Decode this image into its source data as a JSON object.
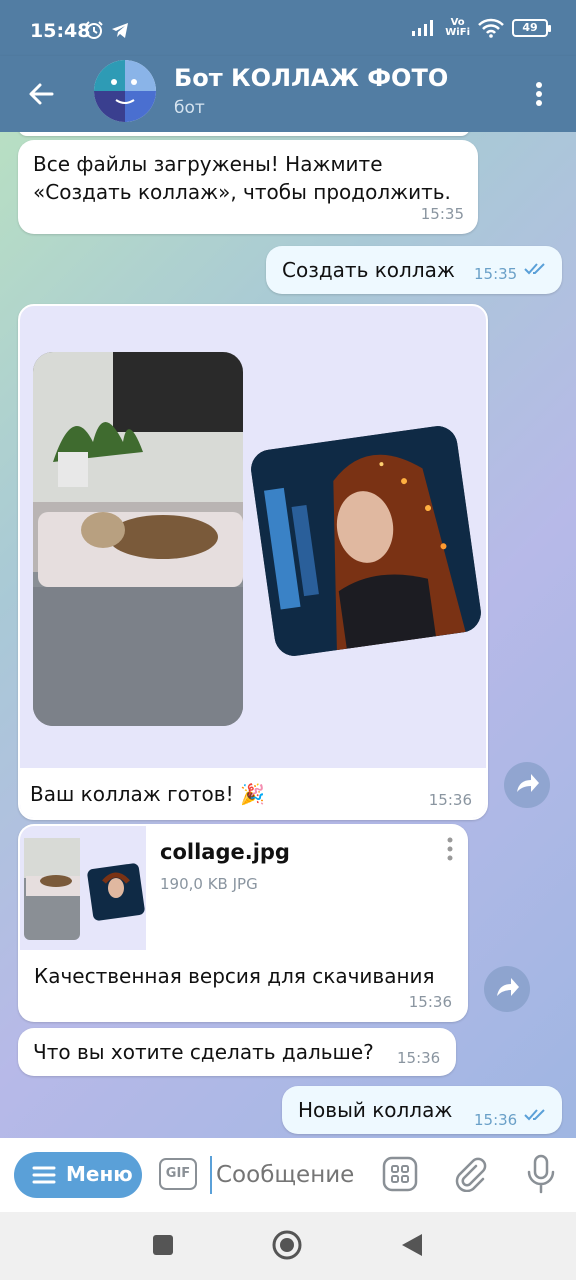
{
  "status": {
    "time": "15:48",
    "vowifi_top": "Vo",
    "vowifi_bottom": "WiFi",
    "battery": "49"
  },
  "header": {
    "title": "Бот КОЛЛАЖ ФОТО",
    "subtitle": "бот"
  },
  "messages": [
    {
      "text": "Все файлы загружены! Нажмите «Создать коллаж», чтобы продолжить.",
      "time": "15:35"
    },
    {
      "text": "Создать коллаж",
      "time": "15:35"
    },
    {
      "text": "Ваш коллаж готов! 🎉",
      "time": "15:36"
    },
    {
      "file_name": "collage.jpg",
      "file_meta": "190,0 KB JPG",
      "text": "Качественная версия для скачивания",
      "time": "15:36"
    },
    {
      "text": "Что вы хотите сделать дальше?",
      "time": "15:36"
    },
    {
      "text": "Новый коллаж",
      "time": "15:36"
    }
  ],
  "input": {
    "menu_label": "Меню",
    "gif_label": "GIF",
    "placeholder": "Сообщение"
  },
  "colors": {
    "header": "#527da3",
    "accent": "#5aa0d8",
    "outgoing": "#eef9ff"
  }
}
